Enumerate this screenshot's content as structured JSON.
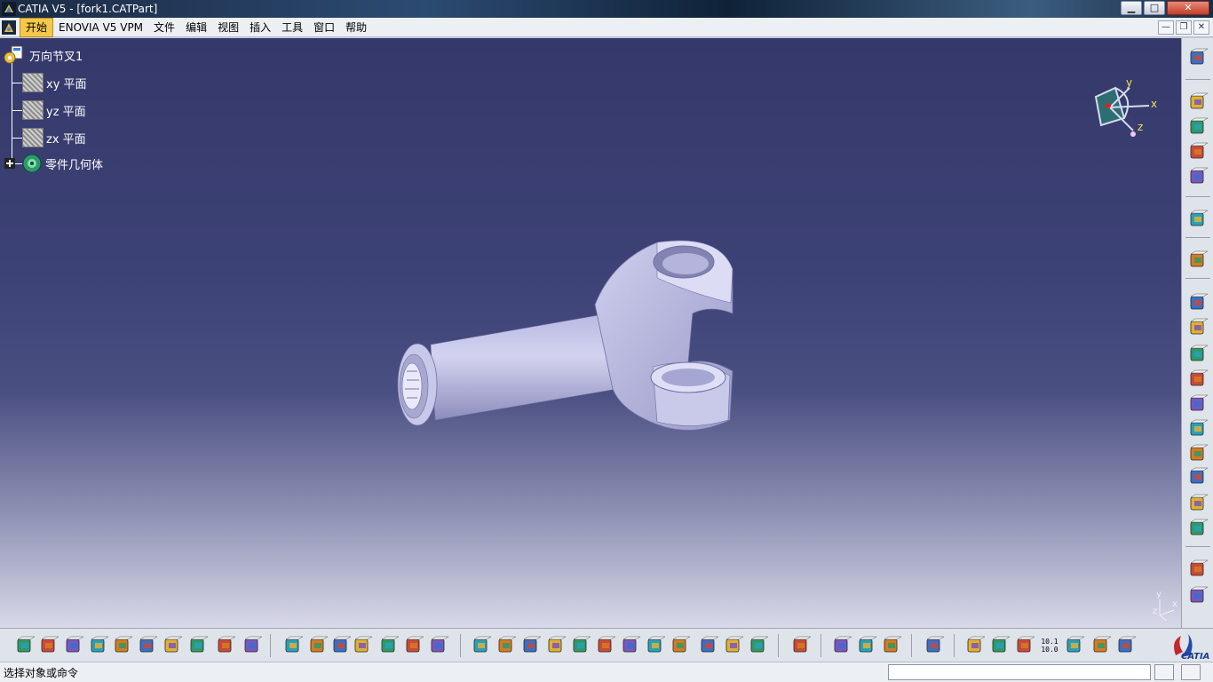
{
  "window": {
    "title": "CATIA V5 - [fork1.CATPart]",
    "buttons": {
      "minimize": "▁",
      "maximize": "□",
      "close": "✕"
    }
  },
  "menubar": {
    "items": [
      "开始",
      "ENOVIA V5 VPM",
      "文件",
      "编辑",
      "视图",
      "插入",
      "工具",
      "窗口",
      "帮助"
    ],
    "active_index": 0,
    "mdi_buttons": {
      "minimize": "—",
      "restore": "❐",
      "close": "✕"
    }
  },
  "tree": {
    "root": {
      "label": "万向节叉1",
      "icon": "part-icon"
    },
    "children": [
      {
        "label": "xy 平面",
        "icon": "plane-icon"
      },
      {
        "label": "yz 平面",
        "icon": "plane-icon"
      },
      {
        "label": "zx 平面",
        "icon": "plane-icon"
      },
      {
        "label": "零件几何体",
        "icon": "body-icon",
        "expandable": true
      }
    ]
  },
  "compass": {
    "x_label": "x",
    "y_label": "y",
    "z_label": "z"
  },
  "axis_indicator": {
    "x_label": "x",
    "y_label": "y",
    "z_label": "z"
  },
  "right_toolbar": {
    "icons": [
      "gear-icon",
      "layer-stack-icon",
      "layer-stack-icon",
      "layer-stack-icon",
      "layer-stack-icon",
      "select-arrow-icon",
      "sketch-icon",
      "pad-icon",
      "pocket-icon",
      "shaft-icon",
      "groove-icon",
      "hole-icon",
      "rib-icon",
      "slot-icon",
      "stiffener-icon",
      "multi-section-solid-icon",
      "removed-multi-section-icon",
      "split-icon",
      "thick-surface-icon"
    ]
  },
  "bottom_toolbar": {
    "icons": [
      "new-icon",
      "open-icon",
      "save-icon",
      "print-icon",
      "cut-icon",
      "copy-icon",
      "paste-icon",
      "undo-icon",
      "redo-icon",
      "whats-this-icon",
      "formula-icon",
      "knowledge-advisor-icon",
      "light-icon",
      "table-icon",
      "tree-expand-icon",
      "lock-icon",
      "parameters-icon",
      "fly-mode-icon",
      "fit-all-icon",
      "pan-icon",
      "rotate-icon",
      "zoom-in-icon",
      "zoom-out-icon",
      "normal-view-icon",
      "multi-view-icon",
      "iso-view-icon",
      "shading-icon",
      "hide-show-icon",
      "swap-space-icon",
      "update-icon",
      "measure-icon",
      "material-icon",
      "apply-material-icon",
      "capture-icon",
      "analysis-icon",
      "hand-icon",
      "axis-system-icon",
      "scale-icon",
      "section-icon",
      "constraint-icon",
      "list-icon"
    ],
    "scale_text": "10.1\n10.0",
    "logo_text": "CATIA"
  },
  "statusbar": {
    "prompt": "选择对象或命令",
    "command_value": ""
  }
}
